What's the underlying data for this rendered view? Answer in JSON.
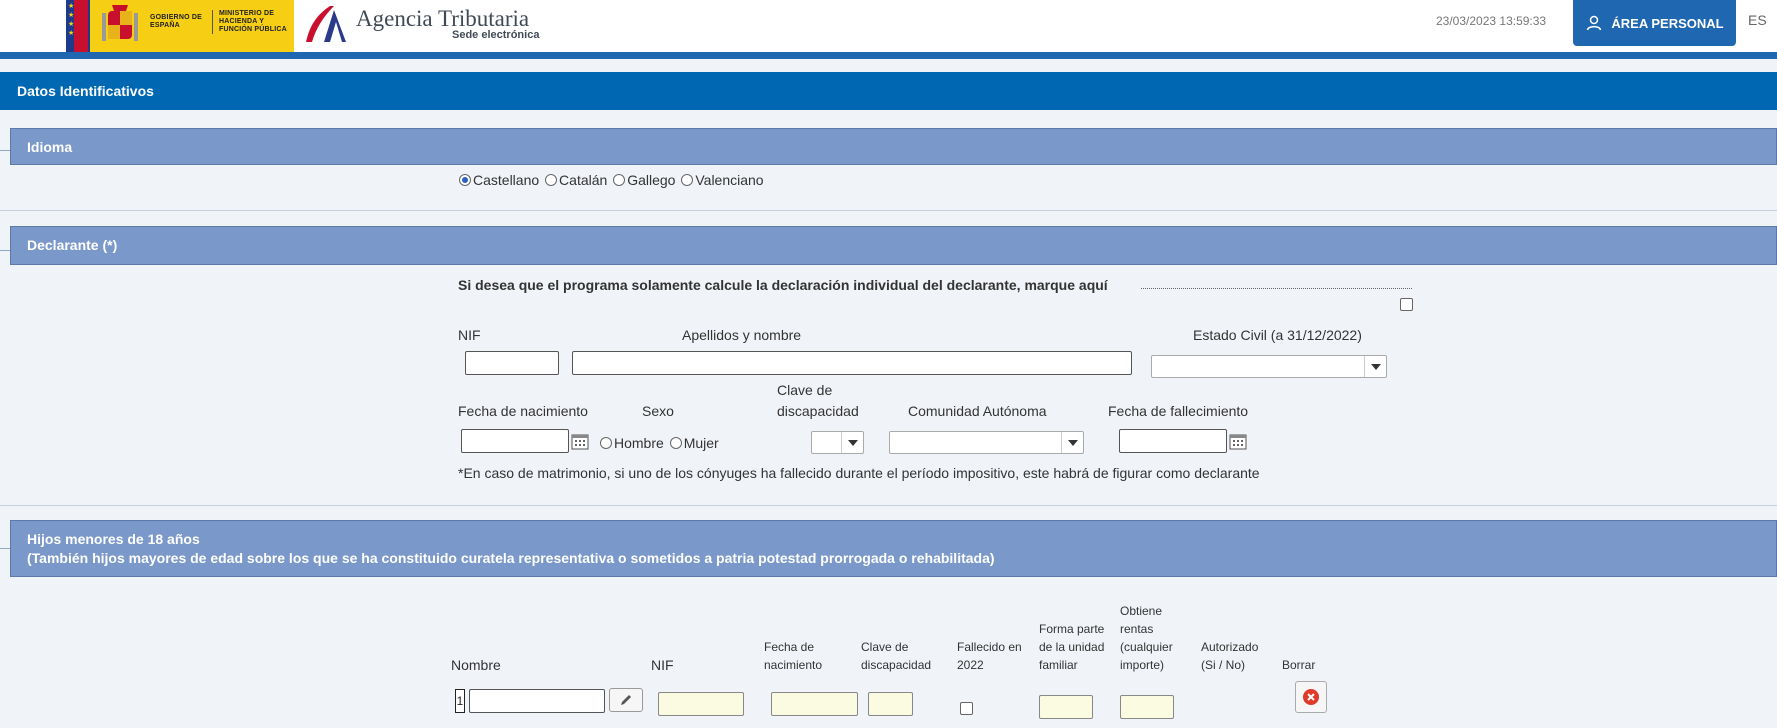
{
  "header": {
    "gov_text_1": "GOBIERNO DE ESPAÑA",
    "gov_text_2": "MINISTERIO DE HACIENDA Y FUNCIÓN PÚBLICA",
    "agency_title": "Agencia Tributaria",
    "agency_subtitle": "Sede electrónica",
    "datetime": "23/03/2023 13:59:33",
    "personal_area_label": "ÁREA PERSONAL",
    "language": "ES"
  },
  "datos_bar": {
    "title": "Datos Identificativos"
  },
  "idioma": {
    "title": "Idioma",
    "options": [
      {
        "label": "Castellano",
        "selected": true
      },
      {
        "label": "Catalán",
        "selected": false
      },
      {
        "label": "Gallego",
        "selected": false
      },
      {
        "label": "Valenciano",
        "selected": false
      }
    ]
  },
  "declarante": {
    "title": "Declarante (*)",
    "individual_note": "Si desea que el programa solamente calcule la declaración individual del declarante, marque aquí",
    "nif_label": "NIF",
    "name_label": "Apellidos y nombre",
    "civil_state_label": "Estado Civil (a 31/12/2022)",
    "birth_label": "Fecha de nacimiento",
    "sex_label": "Sexo",
    "sex_options": [
      "Hombre",
      "Mujer"
    ],
    "disability_label_1": "Clave de",
    "disability_label_2": "discapacidad",
    "community_label": "Comunidad Autónoma",
    "death_label": "Fecha de fallecimiento",
    "footnote": "*En caso de matrimonio, si uno de los cónyuges ha fallecido durante el período impositivo, este habrá de figurar como declarante"
  },
  "hijos": {
    "title_1": "Hijos menores de 18 años",
    "title_2": "(También hijos mayores de edad sobre los que se ha constituido curatela representativa o sometidos a patria potestad prorrogada o rehabilitada)",
    "col_nombre": "Nombre",
    "col_nif": "NIF",
    "col_birth_1": "Fecha de",
    "col_birth_2": "nacimiento",
    "col_disab_1": "Clave de",
    "col_disab_2": "discapacidad",
    "col_dead_1": "Fallecido en",
    "col_dead_2": "2022",
    "col_family_1": "Forma parte",
    "col_family_2": "de la unidad",
    "col_family_3": "familiar",
    "col_income_1": "Obtiene",
    "col_income_2": "rentas",
    "col_income_3": "(cualquier",
    "col_income_4": "importe)",
    "col_auth_1": "Autorizado",
    "col_auth_2": "(Si / No)",
    "col_delete": "Borrar",
    "row_number": "1"
  }
}
